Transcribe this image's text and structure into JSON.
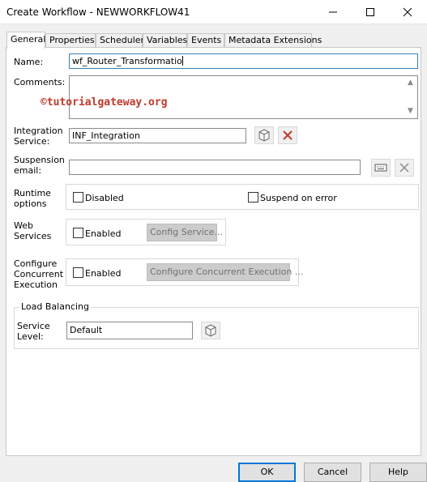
{
  "window": {
    "title": "Create Workflow - NEWWORKFLOW41"
  },
  "tabs": [
    "General",
    "Properties",
    "Scheduler",
    "Variables",
    "Events",
    "Metadata Extensions"
  ],
  "general": {
    "name_label": "Name:",
    "name_value": "wf_Router_Transformatio",
    "comments_label": "Comments:",
    "watermark": "©tutorialgateway.org",
    "integration_label_1": "Integration",
    "integration_label_2": "Service:",
    "integration_value": "INF_Integration",
    "suspension_label_1": "Suspension",
    "suspension_label_2": "email:",
    "suspension_value": "",
    "runtime_label_1": "Runtime",
    "runtime_label_2": "options",
    "disabled_label": "Disabled",
    "suspend_on_error_label": "Suspend on error",
    "web_label_1": "Web",
    "web_label_2": "Services",
    "web_enabled_label": "Enabled",
    "config_service_button": "Config Service...",
    "concurrent_label_1": "Configure",
    "concurrent_label_2": "Concurrent",
    "concurrent_label_3": "Execution",
    "concurrent_enabled_label": "Enabled",
    "configure_concurrent_button": "Configure Concurrent Execution ...",
    "load_balancing_legend": "Load Balancing",
    "service_level_label_1": "Service",
    "service_level_label_2": "Level:",
    "service_level_value": "Default"
  },
  "buttons": {
    "ok": "OK",
    "cancel": "Cancel",
    "help": "Help"
  },
  "colors": {
    "focus_border": "#3c7fb1",
    "default_button_border": "#0078d7",
    "delete_x": "#c0392b",
    "watermark": "#c0392b"
  }
}
